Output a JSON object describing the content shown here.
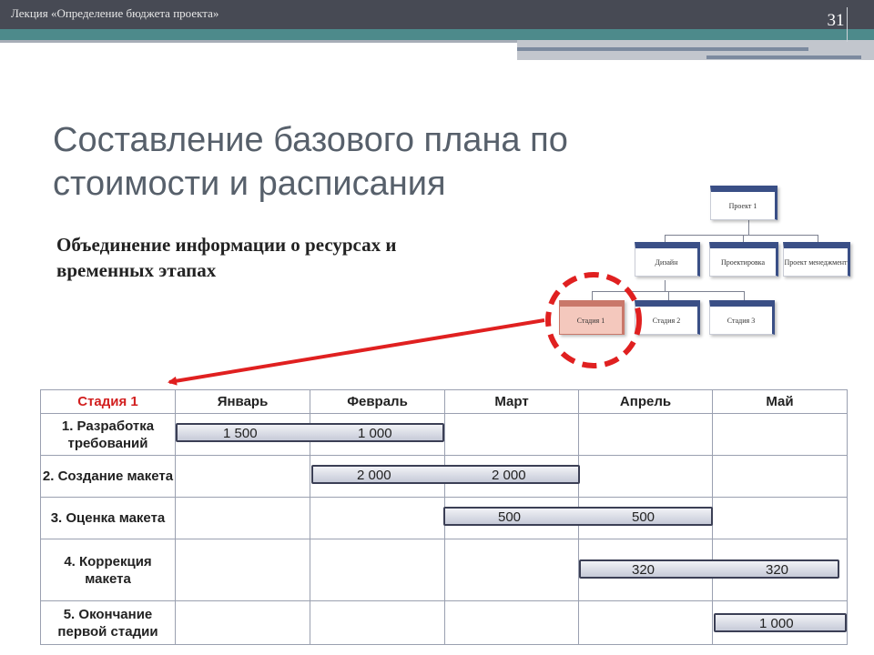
{
  "header": {
    "lecture_title": "Лекция «Определение бюджета проекта»",
    "slide_number": "31"
  },
  "title": "Составление базового плана по стоимости и расписания",
  "subtitle": "Объединение информации о ресурсах и временных этапах",
  "org_chart": {
    "root": "Проект 1",
    "level2": [
      "Дизайн",
      "Проектировка",
      "Проект менеджмент"
    ],
    "level3": [
      "Стадия 1",
      "Стадия 2",
      "Стадия 3"
    ]
  },
  "colors": {
    "highlight_red": "#e02020",
    "header_dark": "#474a54",
    "teal": "#4d8a8b"
  },
  "table": {
    "stage_label": "Стадия 1",
    "months": [
      "Январь",
      "Февраль",
      "Март",
      "Апрель",
      "Май"
    ],
    "tasks": [
      {
        "name": "1. Разработка требований",
        "values": [
          "1 500",
          "1 000"
        ]
      },
      {
        "name": "2. Создание макета",
        "values": [
          "2 000",
          "2 000"
        ]
      },
      {
        "name": "3. Оценка макета",
        "values": [
          "500",
          "500"
        ]
      },
      {
        "name": "4. Коррекция макета",
        "values": [
          "320",
          "320"
        ]
      },
      {
        "name": "5. Окончание первой стадии",
        "values": [
          "1 000"
        ]
      }
    ]
  }
}
